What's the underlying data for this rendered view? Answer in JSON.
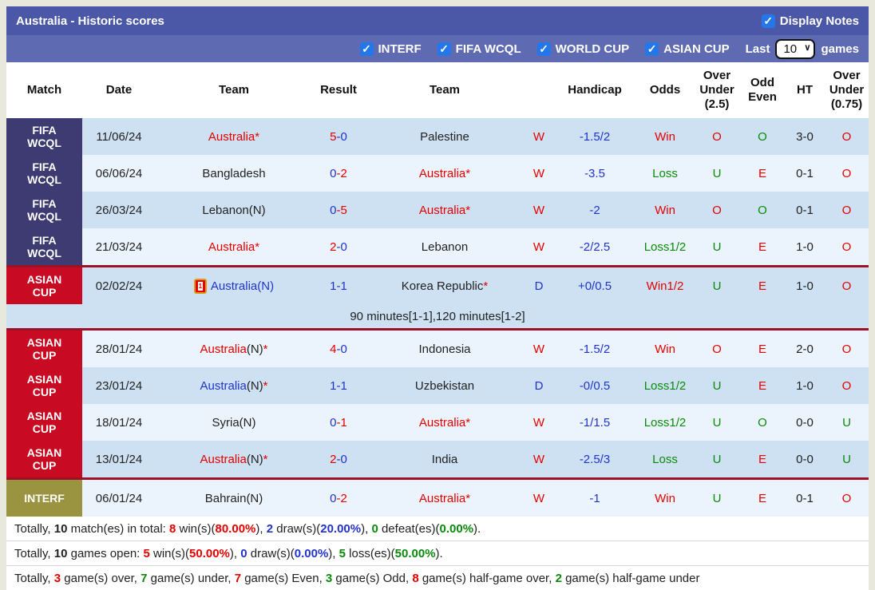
{
  "icons": {
    "check": "✓",
    "red_card": "1"
  },
  "colors": {
    "accent_title_bar": "#4b58a7",
    "accent_filter_bar": "#5e6bb3",
    "checkbox_blue": "#2377e8",
    "fifa_wcql_label": "#3e3b72",
    "asian_cup_label": "#c80b22",
    "interf_label": "#9a9340",
    "win_red": "#e50000",
    "draw_blue": "#2233cc",
    "loss_green": "#0a8a0a",
    "row_dark": "#cde1f2",
    "row_light": "#ebf4fc"
  },
  "title_bar": {
    "title": "Australia - Historic scores",
    "display_notes_label": "Display Notes",
    "display_notes_checked": true
  },
  "filter_bar": {
    "tournaments": [
      {
        "label": "INTERF",
        "checked": true
      },
      {
        "label": "FIFA WCQL",
        "checked": true
      },
      {
        "label": "WORLD CUP",
        "checked": true
      },
      {
        "label": "ASIAN CUP",
        "checked": true
      }
    ],
    "last_label": "Last",
    "last_value": "10",
    "games_label": "games"
  },
  "table": {
    "headers": [
      "Match",
      "Date",
      "Team",
      "Result",
      "Team",
      "",
      "Handicap",
      "Odds",
      "Over Under (2.5)",
      "Odd Even",
      "HT",
      "Over Under (0.75)"
    ],
    "rows": [
      {
        "comp": "FIFA\nWCQL",
        "comp_class": "comp-fifa",
        "shade": "shade-dark",
        "sep": "",
        "icon": "",
        "date": "11/06/24",
        "t1": {
          "name": "Australia",
          "color": "c-red",
          "n": "",
          "n_color": "",
          "star": "*"
        },
        "res": {
          "h": "5",
          "hc": "c-red",
          "a": "-0",
          "ac": "c-blue"
        },
        "t2": {
          "name": "Palestine",
          "color": "c-black",
          "n": "",
          "n_color": "",
          "star": ""
        },
        "wd": {
          "t": "W",
          "c": "c-red"
        },
        "handicap": "-1.5/2",
        "odds": {
          "t": "Win",
          "c": "c-red"
        },
        "ou25": {
          "t": "O",
          "c": "c-red"
        },
        "oe": {
          "t": "O",
          "c": "c-green"
        },
        "ht": "3-0",
        "ou075": {
          "t": "O",
          "c": "c-red"
        },
        "note": ""
      },
      {
        "comp": "FIFA\nWCQL",
        "comp_class": "comp-fifa",
        "shade": "shade-light",
        "sep": "",
        "icon": "",
        "date": "06/06/24",
        "t1": {
          "name": "Bangladesh",
          "color": "c-black",
          "n": "",
          "n_color": "",
          "star": ""
        },
        "res": {
          "h": "0",
          "hc": "c-blue",
          "a": "-2",
          "ac": "c-red"
        },
        "t2": {
          "name": "Australia",
          "color": "c-red",
          "n": "",
          "n_color": "",
          "star": "*"
        },
        "wd": {
          "t": "W",
          "c": "c-red"
        },
        "handicap": "-3.5",
        "odds": {
          "t": "Loss",
          "c": "c-green"
        },
        "ou25": {
          "t": "U",
          "c": "c-green"
        },
        "oe": {
          "t": "E",
          "c": "c-red"
        },
        "ht": "0-1",
        "ou075": {
          "t": "O",
          "c": "c-red"
        },
        "note": ""
      },
      {
        "comp": "FIFA\nWCQL",
        "comp_class": "comp-fifa",
        "shade": "shade-dark",
        "sep": "",
        "icon": "",
        "date": "26/03/24",
        "t1": {
          "name": "Lebanon",
          "color": "c-black",
          "n": "(N)",
          "n_color": "c-black",
          "star": ""
        },
        "res": {
          "h": "0",
          "hc": "c-blue",
          "a": "-5",
          "ac": "c-red"
        },
        "t2": {
          "name": "Australia",
          "color": "c-red",
          "n": "",
          "n_color": "",
          "star": "*"
        },
        "wd": {
          "t": "W",
          "c": "c-red"
        },
        "handicap": "-2",
        "odds": {
          "t": "Win",
          "c": "c-red"
        },
        "ou25": {
          "t": "O",
          "c": "c-red"
        },
        "oe": {
          "t": "O",
          "c": "c-green"
        },
        "ht": "0-1",
        "ou075": {
          "t": "O",
          "c": "c-red"
        },
        "note": ""
      },
      {
        "comp": "FIFA\nWCQL",
        "comp_class": "comp-fifa",
        "shade": "shade-light",
        "sep": "",
        "icon": "",
        "date": "21/03/24",
        "t1": {
          "name": "Australia",
          "color": "c-red",
          "n": "",
          "n_color": "",
          "star": "*"
        },
        "res": {
          "h": "2",
          "hc": "c-red",
          "a": "-0",
          "ac": "c-blue"
        },
        "t2": {
          "name": "Lebanon",
          "color": "c-black",
          "n": "",
          "n_color": "",
          "star": ""
        },
        "wd": {
          "t": "W",
          "c": "c-red"
        },
        "handicap": "-2/2.5",
        "odds": {
          "t": "Loss1/2",
          "c": "c-green"
        },
        "ou25": {
          "t": "U",
          "c": "c-green"
        },
        "oe": {
          "t": "E",
          "c": "c-red"
        },
        "ht": "1-0",
        "ou075": {
          "t": "O",
          "c": "c-red"
        },
        "note": ""
      },
      {
        "comp": "ASIAN\nCUP",
        "comp_class": "comp-asian",
        "shade": "shade-dark",
        "sep": "sep-top",
        "icon": "1",
        "date": "02/02/24",
        "t1": {
          "name": "Australia",
          "color": "c-blue",
          "n": "(N)",
          "n_color": "c-blue",
          "star": ""
        },
        "res": {
          "h": "1",
          "hc": "c-blue",
          "a": "-1",
          "ac": "c-blue"
        },
        "t2": {
          "name": "Korea Republic",
          "color": "c-black",
          "n": "",
          "n_color": "",
          "star": "*"
        },
        "wd": {
          "t": "D",
          "c": "c-blue"
        },
        "handicap": "+0/0.5",
        "odds": {
          "t": "Win1/2",
          "c": "c-red"
        },
        "ou25": {
          "t": "U",
          "c": "c-green"
        },
        "oe": {
          "t": "E",
          "c": "c-red"
        },
        "ht": "1-0",
        "ou075": {
          "t": "O",
          "c": "c-red"
        },
        "note": "90 minutes[1-1],120 minutes[1-2]"
      },
      {
        "comp": "ASIAN\nCUP",
        "comp_class": "comp-asian",
        "shade": "shade-light",
        "sep": "sep-top",
        "icon": "",
        "date": "28/01/24",
        "t1": {
          "name": "Australia",
          "color": "c-red",
          "n": "(N)",
          "n_color": "c-black",
          "star": "*"
        },
        "res": {
          "h": "4",
          "hc": "c-red",
          "a": "-0",
          "ac": "c-blue"
        },
        "t2": {
          "name": "Indonesia",
          "color": "c-black",
          "n": "",
          "n_color": "",
          "star": ""
        },
        "wd": {
          "t": "W",
          "c": "c-red"
        },
        "handicap": "-1.5/2",
        "odds": {
          "t": "Win",
          "c": "c-red"
        },
        "ou25": {
          "t": "O",
          "c": "c-red"
        },
        "oe": {
          "t": "E",
          "c": "c-red"
        },
        "ht": "2-0",
        "ou075": {
          "t": "O",
          "c": "c-red"
        },
        "note": ""
      },
      {
        "comp": "ASIAN\nCUP",
        "comp_class": "comp-asian",
        "shade": "shade-dark",
        "sep": "",
        "icon": "",
        "date": "23/01/24",
        "t1": {
          "name": "Australia",
          "color": "c-blue",
          "n": "(N)",
          "n_color": "c-black",
          "star": "*"
        },
        "res": {
          "h": "1",
          "hc": "c-blue",
          "a": "-1",
          "ac": "c-blue"
        },
        "t2": {
          "name": "Uzbekistan",
          "color": "c-black",
          "n": "",
          "n_color": "",
          "star": ""
        },
        "wd": {
          "t": "D",
          "c": "c-blue"
        },
        "handicap": "-0/0.5",
        "odds": {
          "t": "Loss1/2",
          "c": "c-green"
        },
        "ou25": {
          "t": "U",
          "c": "c-green"
        },
        "oe": {
          "t": "E",
          "c": "c-red"
        },
        "ht": "1-0",
        "ou075": {
          "t": "O",
          "c": "c-red"
        },
        "note": ""
      },
      {
        "comp": "ASIAN\nCUP",
        "comp_class": "comp-asian",
        "shade": "shade-light",
        "sep": "",
        "icon": "",
        "date": "18/01/24",
        "t1": {
          "name": "Syria",
          "color": "c-black",
          "n": "(N)",
          "n_color": "c-black",
          "star": ""
        },
        "res": {
          "h": "0",
          "hc": "c-blue",
          "a": "-1",
          "ac": "c-red"
        },
        "t2": {
          "name": "Australia",
          "color": "c-red",
          "n": "",
          "n_color": "",
          "star": "*"
        },
        "wd": {
          "t": "W",
          "c": "c-red"
        },
        "handicap": "-1/1.5",
        "odds": {
          "t": "Loss1/2",
          "c": "c-green"
        },
        "ou25": {
          "t": "U",
          "c": "c-green"
        },
        "oe": {
          "t": "O",
          "c": "c-green"
        },
        "ht": "0-0",
        "ou075": {
          "t": "U",
          "c": "c-green"
        },
        "note": ""
      },
      {
        "comp": "ASIAN\nCUP",
        "comp_class": "comp-asian",
        "shade": "shade-dark",
        "sep": "",
        "icon": "",
        "date": "13/01/24",
        "t1": {
          "name": "Australia",
          "color": "c-red",
          "n": "(N)",
          "n_color": "c-black",
          "star": "*"
        },
        "res": {
          "h": "2",
          "hc": "c-red",
          "a": "-0",
          "ac": "c-blue"
        },
        "t2": {
          "name": "India",
          "color": "c-black",
          "n": "",
          "n_color": "",
          "star": ""
        },
        "wd": {
          "t": "W",
          "c": "c-red"
        },
        "handicap": "-2.5/3",
        "odds": {
          "t": "Loss",
          "c": "c-green"
        },
        "ou25": {
          "t": "U",
          "c": "c-green"
        },
        "oe": {
          "t": "E",
          "c": "c-red"
        },
        "ht": "0-0",
        "ou075": {
          "t": "U",
          "c": "c-green"
        },
        "note": ""
      },
      {
        "comp": "INTERF",
        "comp_class": "comp-interf",
        "shade": "shade-light",
        "sep": "sep-top",
        "icon": "",
        "date": "06/01/24",
        "t1": {
          "name": "Bahrain",
          "color": "c-black",
          "n": "(N)",
          "n_color": "c-black",
          "star": ""
        },
        "res": {
          "h": "0",
          "hc": "c-blue",
          "a": "-2",
          "ac": "c-red"
        },
        "t2": {
          "name": "Australia",
          "color": "c-red",
          "n": "",
          "n_color": "",
          "star": "*"
        },
        "wd": {
          "t": "W",
          "c": "c-red"
        },
        "handicap": "-1",
        "odds": {
          "t": "Win",
          "c": "c-red"
        },
        "ou25": {
          "t": "U",
          "c": "c-green"
        },
        "oe": {
          "t": "E",
          "c": "c-red"
        },
        "ht": "0-1",
        "ou075": {
          "t": "O",
          "c": "c-red"
        },
        "note": ""
      }
    ]
  },
  "summary": {
    "lines": [
      [
        {
          "t": "Totally, "
        },
        {
          "t": "10",
          "b": true
        },
        {
          "t": " match(es) in total: "
        },
        {
          "t": "8",
          "c": "c-red",
          "b": true
        },
        {
          "t": " win(s)("
        },
        {
          "t": "80.00%",
          "c": "c-red",
          "b": true
        },
        {
          "t": "), "
        },
        {
          "t": "2",
          "c": "c-blue",
          "b": true
        },
        {
          "t": " draw(s)("
        },
        {
          "t": "20.00%",
          "c": "c-blue",
          "b": true
        },
        {
          "t": "), "
        },
        {
          "t": "0",
          "c": "c-green",
          "b": true
        },
        {
          "t": " defeat(es)("
        },
        {
          "t": "0.00%",
          "c": "c-green",
          "b": true
        },
        {
          "t": ")."
        }
      ],
      [
        {
          "t": "Totally, "
        },
        {
          "t": "10",
          "b": true
        },
        {
          "t": " games open: "
        },
        {
          "t": "5",
          "c": "c-red",
          "b": true
        },
        {
          "t": " win(s)("
        },
        {
          "t": "50.00%",
          "c": "c-red",
          "b": true
        },
        {
          "t": "), "
        },
        {
          "t": "0",
          "c": "c-blue",
          "b": true
        },
        {
          "t": " draw(s)("
        },
        {
          "t": "0.00%",
          "c": "c-blue",
          "b": true
        },
        {
          "t": "), "
        },
        {
          "t": "5",
          "c": "c-green",
          "b": true
        },
        {
          "t": " loss(es)("
        },
        {
          "t": "50.00%",
          "c": "c-green",
          "b": true
        },
        {
          "t": ")."
        }
      ],
      [
        {
          "t": "Totally, "
        },
        {
          "t": "3",
          "c": "c-red",
          "b": true
        },
        {
          "t": " game(s) over, "
        },
        {
          "t": "7",
          "c": "c-green",
          "b": true
        },
        {
          "t": " game(s) under, "
        },
        {
          "t": "7",
          "c": "c-red",
          "b": true
        },
        {
          "t": " game(s) Even, "
        },
        {
          "t": "3",
          "c": "c-green",
          "b": true
        },
        {
          "t": " game(s) Odd, "
        },
        {
          "t": "8",
          "c": "c-red",
          "b": true
        },
        {
          "t": " game(s) half-game over, "
        },
        {
          "t": "2",
          "c": "c-green",
          "b": true
        },
        {
          "t": " game(s) half-game under"
        }
      ]
    ]
  }
}
